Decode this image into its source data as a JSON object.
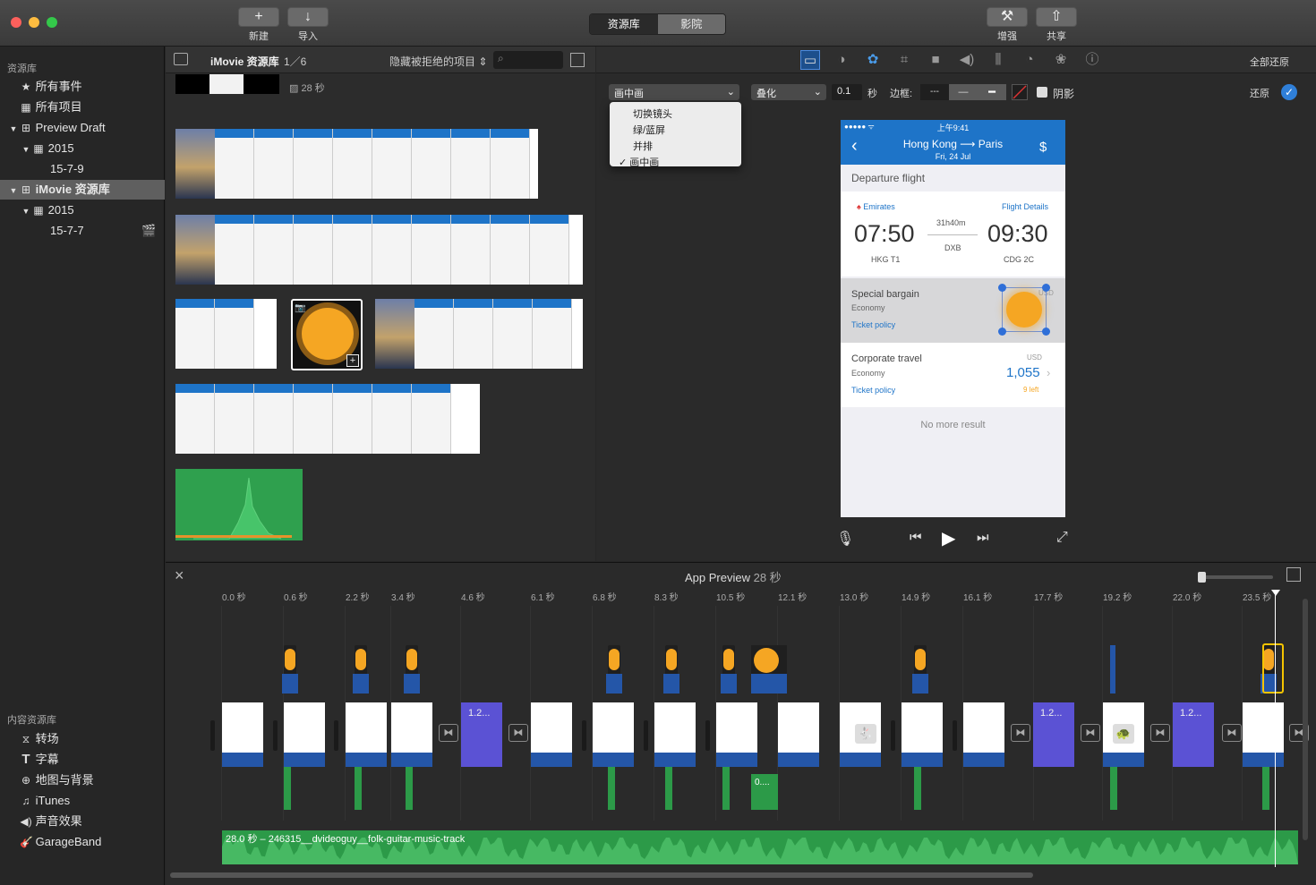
{
  "toolbar": {
    "new": "新建",
    "import": "导入",
    "enhance": "增强",
    "share": "共享",
    "tab_library": "资源库",
    "tab_theater": "影院"
  },
  "sidebar": {
    "library_header": "资源库",
    "items": [
      {
        "label": "所有事件"
      },
      {
        "label": "所有项目"
      },
      {
        "label": "Preview Draft"
      },
      {
        "label": "2015"
      },
      {
        "label": "15-7-9"
      },
      {
        "label": "iMovie 资源库"
      },
      {
        "label": "2015"
      },
      {
        "label": "15-7-7"
      }
    ],
    "content_header": "内容资源库",
    "content": [
      {
        "label": "转场"
      },
      {
        "label": "字幕"
      },
      {
        "label": "地图与背景"
      },
      {
        "label": "iTunes"
      },
      {
        "label": "声音效果"
      },
      {
        "label": "GarageBand"
      }
    ]
  },
  "browser": {
    "title": "iMovie 资源库",
    "page": "1／6",
    "filter": "隐藏被拒绝的项目",
    "duration": "28 秒"
  },
  "viewer": {
    "reset_all": "全部还原",
    "reset": "还原",
    "overlay_select": "画中画",
    "blend_select": "叠化",
    "duration_value": "0.1",
    "duration_unit": "秒",
    "border_label": "边框:",
    "shadow_label": "阴影",
    "dropdown": [
      {
        "label": "切换镜头"
      },
      {
        "label": "绿/蓝屏"
      },
      {
        "label": "并排"
      },
      {
        "label": "画中画",
        "checked": true
      }
    ],
    "phone": {
      "status_time": "上午9:41",
      "status_carrier": "●●●●● ᯤ",
      "route": "Hong Kong ⟶ Paris",
      "date": "Fri, 24 Jul",
      "section": "Departure flight",
      "airline": "Emirates",
      "details": "Flight Details",
      "dep_time": "07:50",
      "arr_time": "09:30",
      "duration": "31h40m",
      "via": "DXB",
      "dep_airport": "HKG T1",
      "arr_airport": "CDG 2C",
      "fare1_title": "Special bargain",
      "fare1_class": "Economy",
      "fare1_policy": "Ticket policy",
      "fare1_currency": "USD",
      "fare2_title": "Corporate travel",
      "fare2_class": "Economy",
      "fare2_policy": "Ticket policy",
      "fare2_currency": "USD",
      "fare2_price": "1,055",
      "fare2_left": "9 left",
      "no_more": "No more result"
    }
  },
  "timeline": {
    "project": "App Preview",
    "duration": "28 秒",
    "ticks": [
      "0.0 秒",
      "0.6 秒",
      "2.2 秒",
      "3.4 秒",
      "4.6 秒",
      "6.1 秒",
      "6.8 秒",
      "8.3 秒",
      "10.5 秒",
      "12.1 秒",
      "13.0 秒",
      "14.9 秒",
      "16.1 秒",
      "17.7 秒",
      "19.2 秒",
      "22.0 秒",
      "23.5 秒"
    ],
    "title_clip": "1.2...",
    "audio_clip_label": "0....",
    "music": "28.0 秒 – 246315__dvideoguy__folk-guitar-music-track"
  },
  "colors": {
    "accent": "#2f7fd8",
    "clip_blue": "#2456a8",
    "audio_green": "#2c9a48",
    "title_purple": "#5b52d4",
    "overlay_orange": "#f5a623"
  }
}
